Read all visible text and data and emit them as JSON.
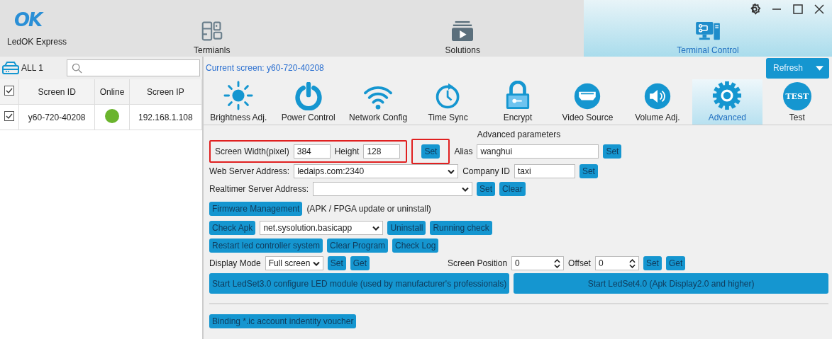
{
  "app": {
    "logo": "OK",
    "name": "LedOK Express"
  },
  "nav": [
    {
      "label": "Termianls",
      "selected": false
    },
    {
      "label": "Solutions",
      "selected": false
    },
    {
      "label": "Terminal Control",
      "selected": true
    }
  ],
  "sidebar": {
    "count_label": "ALL 1",
    "table": {
      "select_all": true,
      "columns": [
        "Screen ID",
        "Online",
        "Screen IP"
      ],
      "rows": [
        {
          "checked": true,
          "screen_id": "y60-720-40208",
          "online": true,
          "screen_ip": "192.168.1.108"
        }
      ]
    }
  },
  "current_screen": "Current screen: y60-720-40208",
  "refresh": "Refresh",
  "tools": [
    {
      "label": "Brightness Adj.",
      "selected": false
    },
    {
      "label": "Power Control",
      "selected": false
    },
    {
      "label": "Network Config",
      "selected": false
    },
    {
      "label": "Time Sync",
      "selected": false
    },
    {
      "label": "Encrypt",
      "selected": false
    },
    {
      "label": "Video Source",
      "selected": false
    },
    {
      "label": "Volume Adj.",
      "selected": false
    },
    {
      "label": "Advanced",
      "selected": true
    },
    {
      "label": "Test",
      "badge": "TEST",
      "selected": false
    }
  ],
  "advanced": {
    "title": "Advanced parameters",
    "lines": [
      {
        "items": [
          {
            "kind": "group",
            "highlighted": true,
            "items": [
              {
                "kind": "label",
                "text": "Screen Width(pixel)"
              },
              {
                "kind": "input",
                "value": "384"
              },
              {
                "kind": "label",
                "text": "Height"
              },
              {
                "kind": "input",
                "value": "128"
              }
            ]
          },
          {
            "kind": "button",
            "text": "Set",
            "highlighted": true
          },
          {
            "kind": "label",
            "text": "Alias"
          },
          {
            "kind": "input",
            "value": "wanghui"
          },
          {
            "kind": "button",
            "text": "Set"
          }
        ]
      },
      {
        "items": [
          {
            "kind": "label",
            "text": "Web Server Address:"
          },
          {
            "kind": "select",
            "value": "ledaips.com:2340"
          },
          {
            "kind": "label",
            "text": "Company ID"
          },
          {
            "kind": "input",
            "value": "taxi"
          },
          {
            "kind": "button",
            "text": "Set"
          }
        ]
      },
      {
        "items": [
          {
            "kind": "label",
            "text": "Realtimer Server Address:"
          },
          {
            "kind": "select"
          },
          {
            "kind": "button",
            "text": "Set"
          },
          {
            "kind": "button",
            "text": "Clear"
          }
        ]
      },
      {
        "items": [
          {
            "kind": "button",
            "text": "Firmware Management"
          },
          {
            "kind": "label",
            "text": "(APK / FPGA update or uninstall)"
          }
        ]
      },
      {
        "items": [
          {
            "kind": "button",
            "text": "Check Apk"
          },
          {
            "kind": "select",
            "value": "net.sysolution.basicapp"
          },
          {
            "kind": "button",
            "text": "Uninstall"
          },
          {
            "kind": "button",
            "text": "Running check"
          }
        ]
      },
      {
        "items": [
          {
            "kind": "button",
            "text": "Restart led controller system"
          },
          {
            "kind": "button",
            "text": "Clear Program"
          },
          {
            "kind": "button",
            "text": "Check Log"
          }
        ]
      },
      {
        "items": [
          {
            "kind": "label",
            "text": "Display Mode"
          },
          {
            "kind": "select",
            "value": "Full screen"
          },
          {
            "kind": "button",
            "text": "Set"
          },
          {
            "kind": "button",
            "text": "Get"
          },
          {
            "kind": "label",
            "text": "Screen Position"
          },
          {
            "kind": "spin",
            "value": "0"
          },
          {
            "kind": "label",
            "text": "Offset"
          },
          {
            "kind": "spin",
            "value": "0"
          },
          {
            "kind": "button",
            "text": "Set"
          },
          {
            "kind": "button",
            "text": "Get"
          }
        ]
      },
      {
        "items": [
          {
            "kind": "wide",
            "text": "Start LedSet3.0 configure LED module (used by manufacturer's professionals)"
          },
          {
            "kind": "wide",
            "text": "Start LedSet4.0 (Apk Display2.0 and higher)"
          }
        ]
      },
      {
        "items": [
          {
            "kind": "rule"
          }
        ]
      },
      {
        "items": [
          {
            "kind": "button",
            "text": "Binding *.ic account indentity voucher"
          }
        ]
      }
    ]
  }
}
